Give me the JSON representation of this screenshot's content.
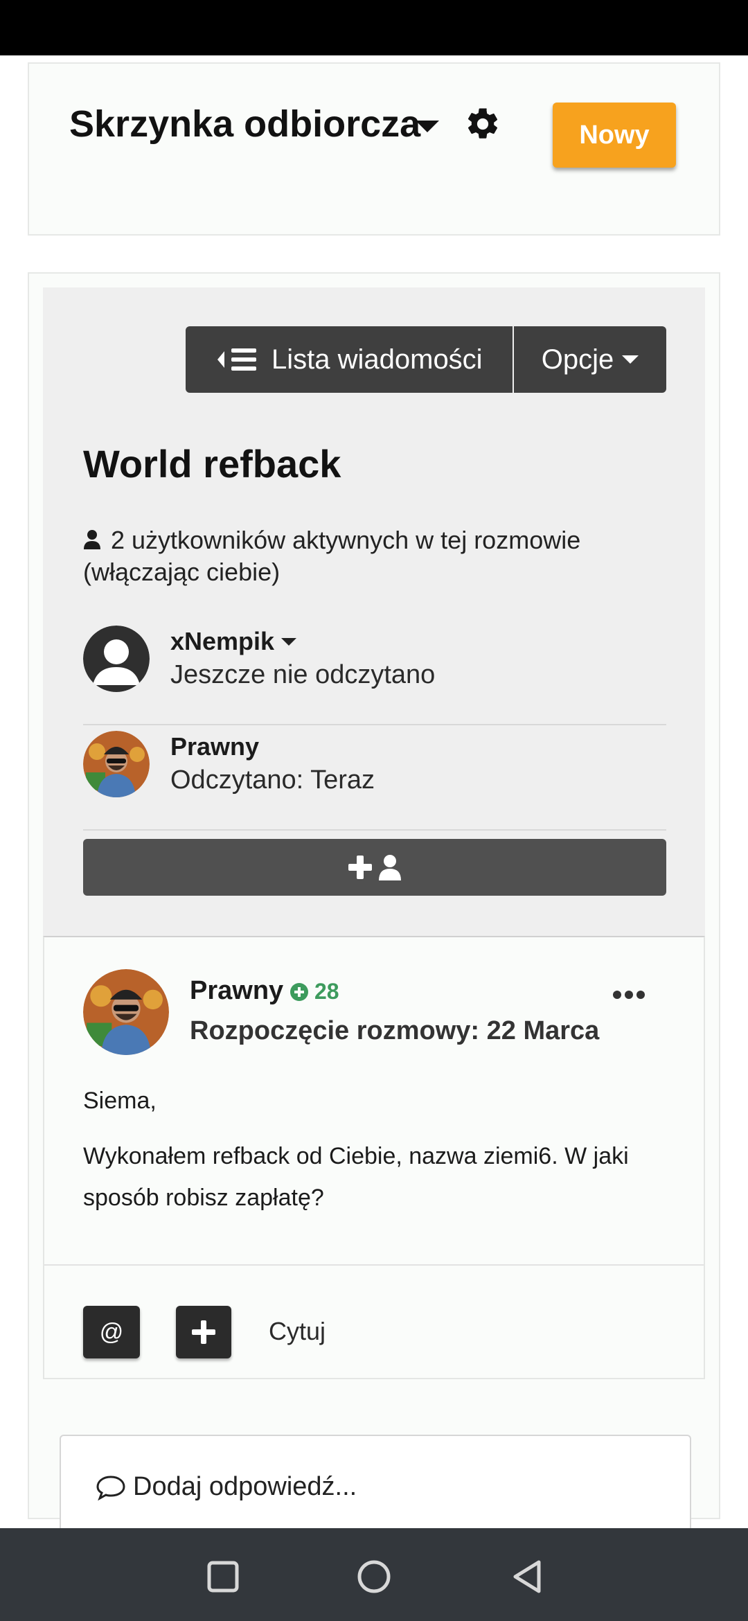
{
  "header": {
    "title": "Skrzynka odbiorcza",
    "new_button": "Nowy",
    "accent_color": "#f7a21e"
  },
  "toolbar": {
    "message_list_label": "Lista wiadomości",
    "options_label": "Opcje"
  },
  "conversation": {
    "title": "World refback",
    "active_users_text": "2 użytkowników aktywnych w tej rozmowie (włączając ciebie)",
    "participants": [
      {
        "name": "xNempik",
        "status": "Jeszcze nie odczytano"
      },
      {
        "name": "Prawny",
        "status": "Odczytano: Teraz"
      }
    ]
  },
  "post": {
    "author": "Prawny",
    "reputation": "28",
    "date_line": "Rozpoczęcie rozmowy: 22 Marca",
    "body": [
      "Siema,",
      "Wykonałem refback od Ciebie, nazwa ziemi6. W jaki sposób robisz zapłatę?"
    ],
    "mention_label": "@",
    "quote_label": "Cytuj"
  },
  "reply": {
    "placeholder": "Dodaj odpowiedź..."
  },
  "icons": {
    "settings": "gear-icon",
    "list": "list-icon",
    "user": "user-icon",
    "add_participant": "add-user-icon",
    "more": "more-icon",
    "comment": "comment-icon"
  }
}
